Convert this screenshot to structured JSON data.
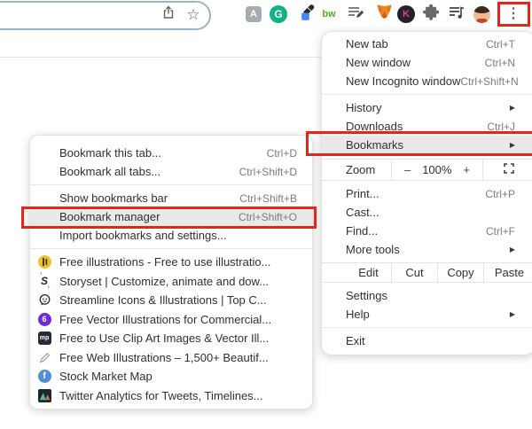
{
  "colors": {
    "annotation_red": "#e1261d",
    "highlight_gray": "#e9e9e9",
    "grammarly_teal": "#12b286",
    "metamask_orange": "#f5841f",
    "omnibox_border": "#9db3c8"
  },
  "toolbar": {
    "address_value": "",
    "menu_button_glyph": "⋮",
    "extension_letters": {
      "pdf": "A",
      "grammarly": "G",
      "bw": "bw",
      "keeper": "K"
    }
  },
  "main_menu": {
    "new_tab": {
      "label": "New tab",
      "shortcut": "Ctrl+T"
    },
    "new_window": {
      "label": "New window",
      "shortcut": "Ctrl+N"
    },
    "new_incognito": {
      "label": "New Incognito window",
      "shortcut": "Ctrl+Shift+N"
    },
    "history": {
      "label": "History"
    },
    "downloads": {
      "label": "Downloads",
      "shortcut": "Ctrl+J"
    },
    "bookmarks": {
      "label": "Bookmarks"
    },
    "zoom": {
      "label": "Zoom",
      "out": "–",
      "value": "100%",
      "in": "+"
    },
    "print": {
      "label": "Print...",
      "shortcut": "Ctrl+P"
    },
    "cast": {
      "label": "Cast..."
    },
    "find": {
      "label": "Find...",
      "shortcut": "Ctrl+F"
    },
    "more_tools": {
      "label": "More tools"
    },
    "edit": {
      "label": "Edit",
      "cut": "Cut",
      "copy": "Copy",
      "paste": "Paste"
    },
    "settings": {
      "label": "Settings"
    },
    "help": {
      "label": "Help"
    },
    "exit": {
      "label": "Exit"
    }
  },
  "bookmarks_submenu": {
    "bookmark_this_tab": {
      "label": "Bookmark this tab...",
      "shortcut": "Ctrl+D"
    },
    "bookmark_all_tabs": {
      "label": "Bookmark all tabs...",
      "shortcut": "Ctrl+Shift+D"
    },
    "show_bookmarks_bar": {
      "label": "Show bookmarks bar",
      "shortcut": "Ctrl+Shift+B"
    },
    "bookmark_manager": {
      "label": "Bookmark manager",
      "shortcut": "Ctrl+Shift+O"
    },
    "import_bookmarks": {
      "label": "Import bookmarks and settings..."
    },
    "bookmarks": [
      {
        "label": "Free illustrations - Free to use illustratio...",
        "icon": "icons8-illustrations-icon"
      },
      {
        "label": "Storyset | Customize, animate and dow...",
        "icon": "storyset-icon",
        "badge": "S"
      },
      {
        "label": "Streamline Icons & Illustrations | Top C...",
        "icon": "streamline-face-icon"
      },
      {
        "label": "Free Vector Illustrations for Commercial...",
        "icon": "purple-vector-icon",
        "badge": "6"
      },
      {
        "label": "Free to Use Clip Art Images & Vector Ill...",
        "icon": "mp-clipart-icon",
        "badge": "mp"
      },
      {
        "label": "Free Web Illustrations – 1,500+ Beautif...",
        "icon": "pencil-icon"
      },
      {
        "label": "Stock Market Map",
        "icon": "finviz-icon",
        "badge": "f"
      },
      {
        "label": "Twitter Analytics for Tweets, Timelines...",
        "icon": "chart-triangles-icon"
      }
    ]
  }
}
